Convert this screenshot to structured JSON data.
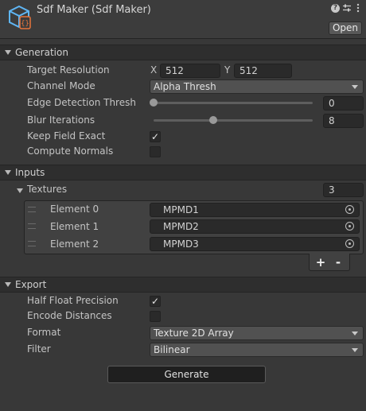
{
  "header": {
    "title": "Sdf Maker (Sdf Maker)",
    "open_label": "Open",
    "icons": [
      "script-icon",
      "help-icon",
      "preset-icon",
      "more-icon"
    ]
  },
  "generation": {
    "title": "Generation",
    "target_resolution": {
      "label": "Target Resolution",
      "x_label": "X",
      "x_value": "512",
      "y_label": "Y",
      "y_value": "512"
    },
    "channel_mode": {
      "label": "Channel Mode",
      "value": "Alpha Thresh"
    },
    "edge_detection": {
      "label": "Edge Detection Thresh",
      "value": "0",
      "level": 0.0
    },
    "blur_iterations": {
      "label": "Blur Iterations",
      "value": "8",
      "level": 0.375
    },
    "keep_field_exact": {
      "label": "Keep Field Exact",
      "checked": true
    },
    "compute_normals": {
      "label": "Compute Normals",
      "checked": false
    }
  },
  "inputs": {
    "title": "Inputs",
    "textures": {
      "label": "Textures",
      "count": "3",
      "elements": [
        {
          "label": "Element 0",
          "value": "MPMD1"
        },
        {
          "label": "Element 1",
          "value": "MPMD2"
        },
        {
          "label": "Element 2",
          "value": "MPMD3"
        }
      ],
      "add_label": "+",
      "remove_label": "-"
    }
  },
  "export": {
    "title": "Export",
    "half_float": {
      "label": "Half Float Precision",
      "checked": true
    },
    "encode_distances": {
      "label": "Encode Distances",
      "checked": false
    },
    "format": {
      "label": "Format",
      "value": "Texture 2D Array"
    },
    "filter": {
      "label": "Filter",
      "value": "Bilinear"
    }
  },
  "generate_label": "Generate",
  "colors": {
    "background": "#383838",
    "section": "#2e2e2e",
    "field": "#2a2a2a",
    "accent": "#3a9bf0"
  }
}
